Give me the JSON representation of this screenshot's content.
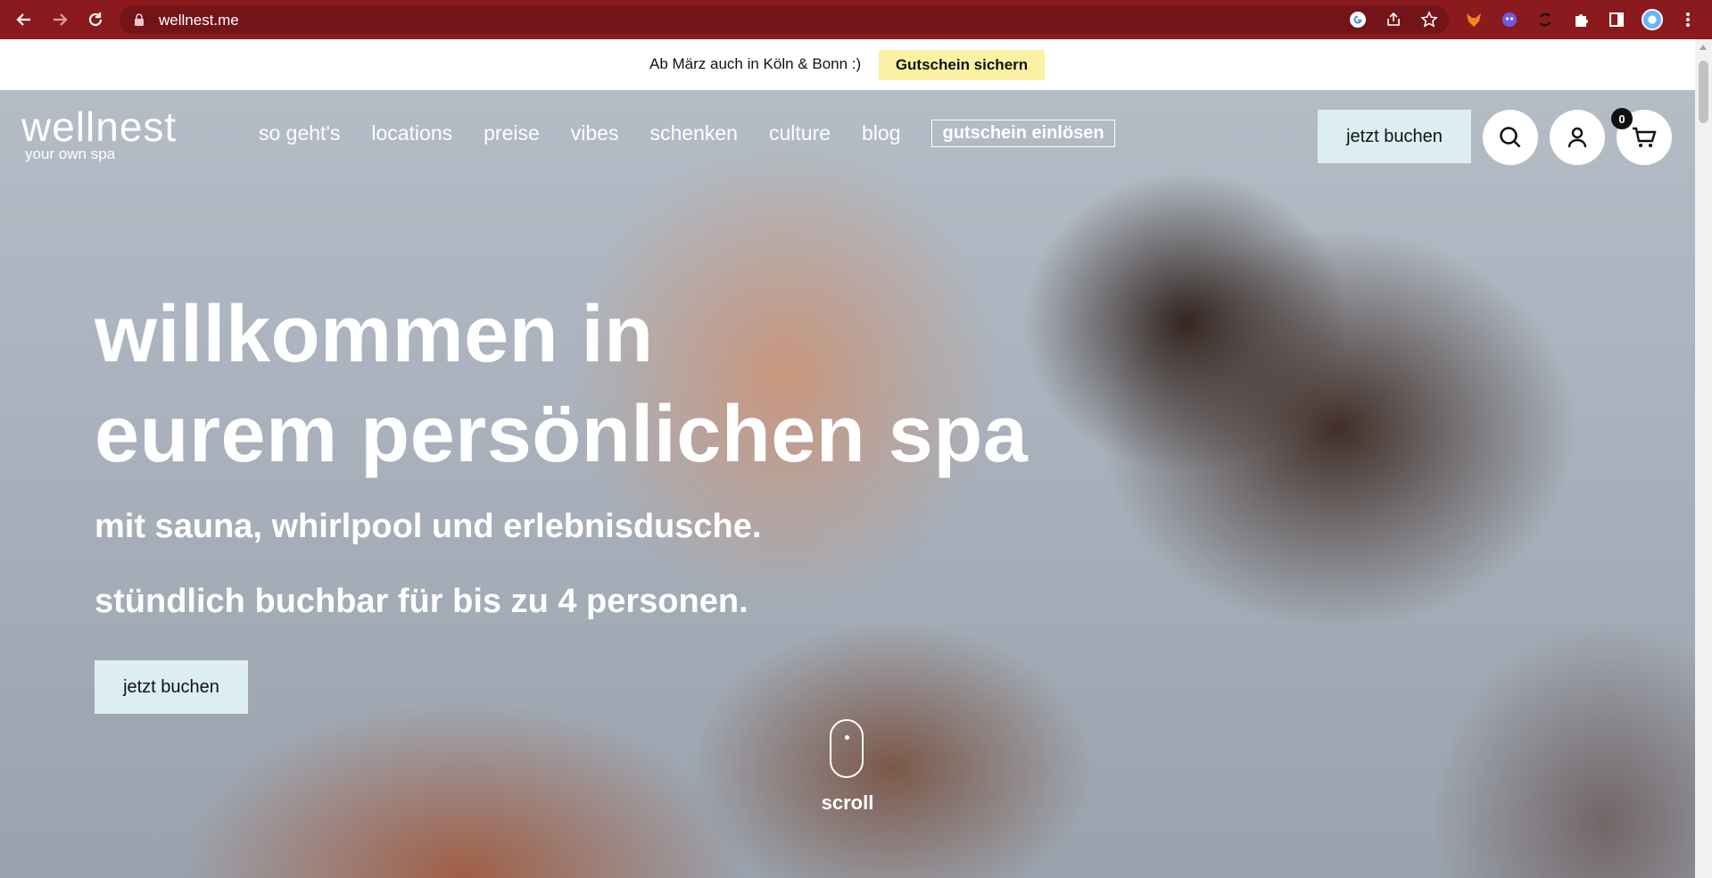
{
  "browser": {
    "url": "wellnest.me",
    "back_icon": "arrow-left-icon",
    "forward_icon": "arrow-right-icon",
    "reload_icon": "reload-icon",
    "accent_color": "#8b1a1f"
  },
  "promo": {
    "text": "Ab März auch in Köln & Bonn :)",
    "button": "Gutschein sichern",
    "button_color": "#fbf1a5"
  },
  "header": {
    "logo_word": "wellnest",
    "logo_tagline": "your own spa",
    "nav": [
      "so geht's",
      "locations",
      "preise",
      "vibes",
      "schenken",
      "culture",
      "blog"
    ],
    "voucher_link": "gutschein einlösen",
    "book_button": "jetzt buchen",
    "cart_count": "0",
    "button_color": "#dceef2"
  },
  "hero": {
    "headline_line1": "willkommen in",
    "headline_line2": "eurem persönlichen spa",
    "sub1": "mit sauna, whirlpool und erlebnisdusche.",
    "sub2": "stündlich buchbar für bis zu 4 personen.",
    "book_button": "jetzt buchen",
    "scroll_label": "scroll"
  }
}
